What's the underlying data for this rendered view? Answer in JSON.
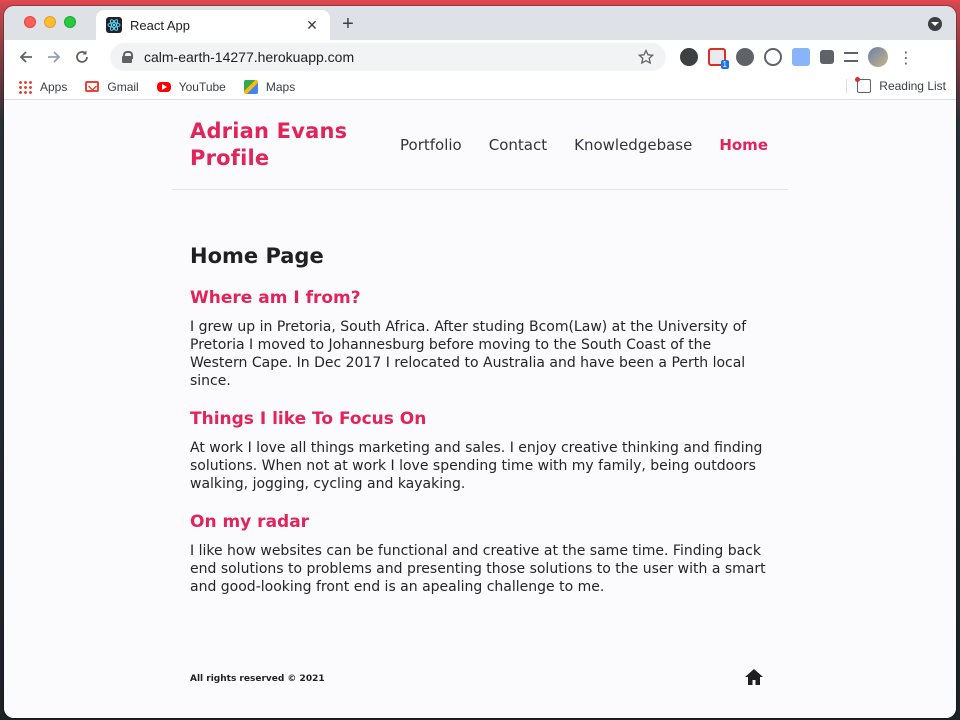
{
  "browser": {
    "tab_title": "React App",
    "tab_close": "✕",
    "new_tab": "+",
    "url": "calm-earth-14277.herokuapp.com",
    "extension_badge": "1",
    "bookmarks": [
      {
        "label": "Apps",
        "icon": "apps-icon"
      },
      {
        "label": "Gmail",
        "icon": "gmail-icon"
      },
      {
        "label": "YouTube",
        "icon": "youtube-icon"
      },
      {
        "label": "Maps",
        "icon": "maps-icon"
      }
    ],
    "reading_list": "Reading List"
  },
  "site": {
    "brand": "Adrian Evans Profile",
    "nav": [
      {
        "label": "Portfolio",
        "active": false
      },
      {
        "label": "Contact",
        "active": false
      },
      {
        "label": "Knowledgebase",
        "active": false
      },
      {
        "label": "Home",
        "active": true
      }
    ],
    "accent_color": "#e1245a"
  },
  "main": {
    "title": "Home Page",
    "sections": [
      {
        "heading": "Where am I from?",
        "body": "I grew up in Pretoria, South Africa. After studing Bcom(Law) at the University of Pretoria I moved to Johannesburg before moving to the South Coast of the Western Cape. In Dec 2017 I relocated to Australia and have been a Perth local since."
      },
      {
        "heading": "Things I like To Focus On",
        "body": "At work I love all things marketing and sales. I enjoy creative thinking and finding solutions. When not at work I love spending time with my family, being outdoors walking, jogging, cycling and kayaking."
      },
      {
        "heading": "On my radar",
        "body": "I like how websites can be functional and creative at the same time. Finding back end solutions to problems and presenting those solutions to the user with a smart and good-looking front end is an apealing challenge to me."
      }
    ]
  },
  "footer": {
    "copyright": "All rights reserved © 2021",
    "home_icon": "home-icon"
  }
}
